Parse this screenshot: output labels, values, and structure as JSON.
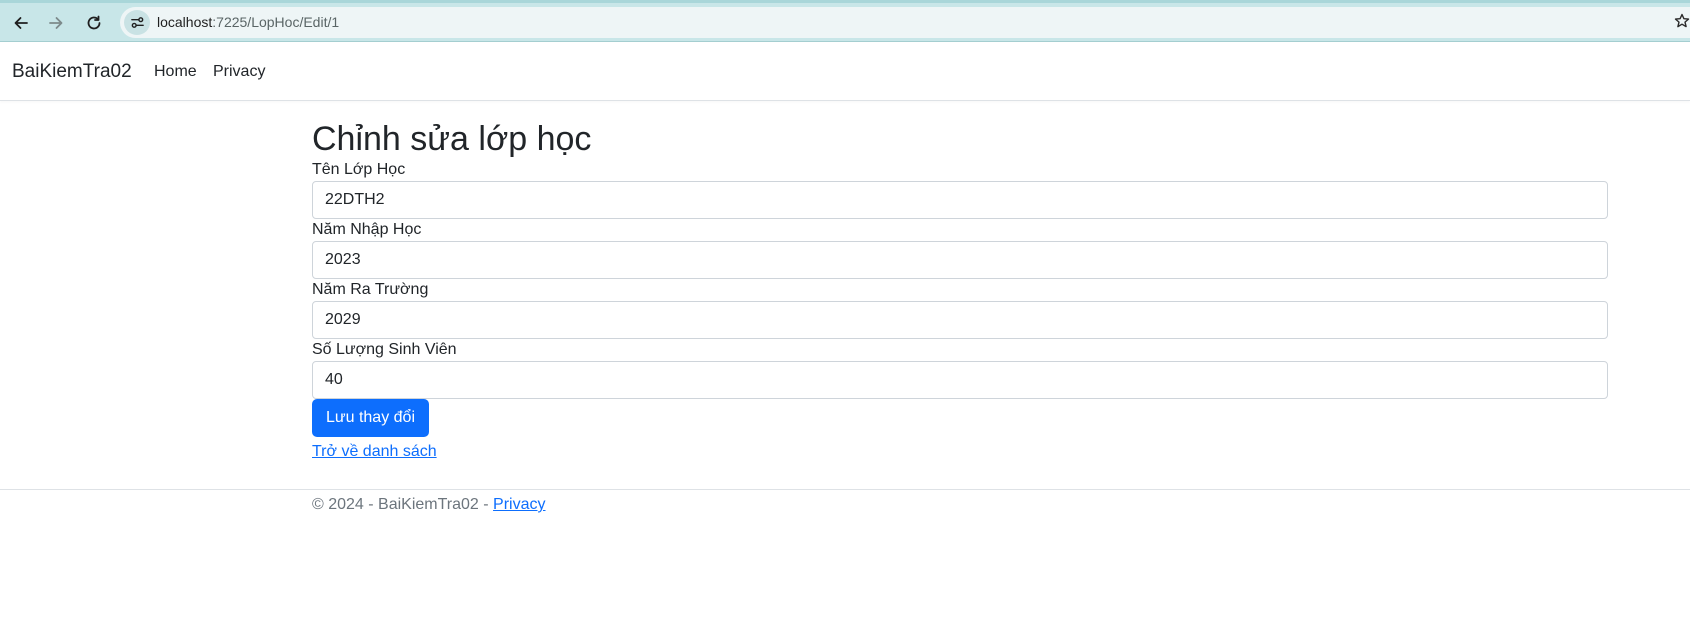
{
  "browser": {
    "url_host": "localhost",
    "url_path": ":7225/LopHoc/Edit/1"
  },
  "navbar": {
    "brand": "BaiKiemTra02",
    "links": [
      "Home",
      "Privacy"
    ]
  },
  "main": {
    "title": "Chỉnh sửa lớp học",
    "fields": [
      {
        "label": "Tên Lớp Học",
        "value": "22DTH2"
      },
      {
        "label": "Năm Nhập Học",
        "value": "2023"
      },
      {
        "label": "Năm Ra Trường",
        "value": "2029"
      },
      {
        "label": "Số Lượng Sinh Viên",
        "value": "40"
      }
    ],
    "save_label": "Lưu thay đổi",
    "back_label": "Trở về danh sách"
  },
  "footer": {
    "text": "© 2024 - BaiKiemTra02 - ",
    "link": "Privacy"
  },
  "colors": {
    "primary": "#0d6efd",
    "chrome": "#c8e6e8"
  }
}
